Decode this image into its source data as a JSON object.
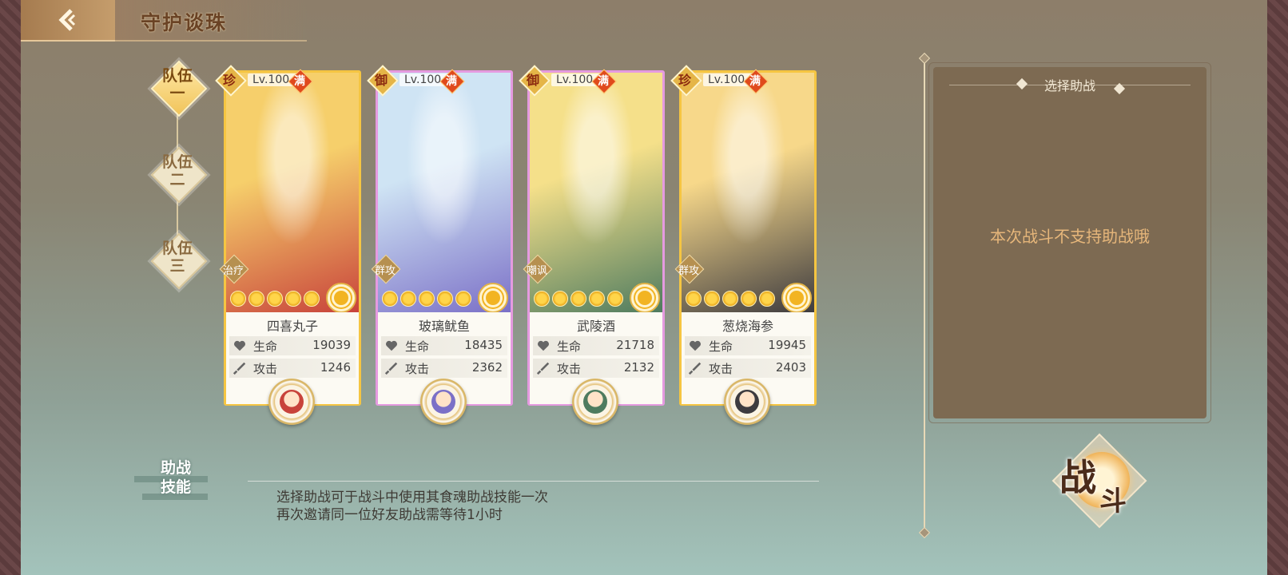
{
  "header": {
    "title": "守护谈珠"
  },
  "teams": [
    {
      "line1": "队伍",
      "line2": "一",
      "active": true
    },
    {
      "line1": "队伍",
      "line2": "二",
      "active": false
    },
    {
      "line1": "队伍",
      "line2": "三",
      "active": false
    }
  ],
  "cards": [
    {
      "name": "四喜丸子",
      "rarity": "珍",
      "level": "Lv.100",
      "full": "满",
      "role": "治疗",
      "stars": 5,
      "hp_label": "生命",
      "hp": "19039",
      "atk_label": "攻击",
      "atk": "1246",
      "frame": "#f5c542",
      "art_colors": [
        "#f6cf6b",
        "#c8433b"
      ]
    },
    {
      "name": "玻璃鱿鱼",
      "rarity": "御",
      "level": "Lv.100",
      "full": "满",
      "role": "群攻",
      "stars": 5,
      "hp_label": "生命",
      "hp": "18435",
      "atk_label": "攻击",
      "atk": "2362",
      "frame": "#e59ae0",
      "art_colors": [
        "#cfe4f4",
        "#7b70c7"
      ]
    },
    {
      "name": "武陵酒",
      "rarity": "御",
      "level": "Lv.100",
      "full": "满",
      "role": "嘲讽",
      "stars": 5,
      "hp_label": "生命",
      "hp": "21718",
      "atk_label": "攻击",
      "atk": "2132",
      "frame": "#e59ae0",
      "art_colors": [
        "#f5e08a",
        "#4e7b5f"
      ]
    },
    {
      "name": "葱烧海参",
      "rarity": "珍",
      "level": "Lv.100",
      "full": "满",
      "role": "群攻",
      "stars": 5,
      "hp_label": "生命",
      "hp": "19945",
      "atk_label": "攻击",
      "atk": "2403",
      "frame": "#f5c542",
      "art_colors": [
        "#f7d88a",
        "#3d3b3f"
      ]
    }
  ],
  "support": {
    "title": "选择助战",
    "message": "本次战斗不支持助战哦"
  },
  "help": {
    "label_line1": "助战",
    "label_line2": "技能",
    "line1": "选择助战可于战斗中使用其食魂助战技能一次",
    "line2": "再次邀请同一位好友助战需等待1小时"
  },
  "battle_button": {
    "char1": "战",
    "char2": "斗"
  }
}
